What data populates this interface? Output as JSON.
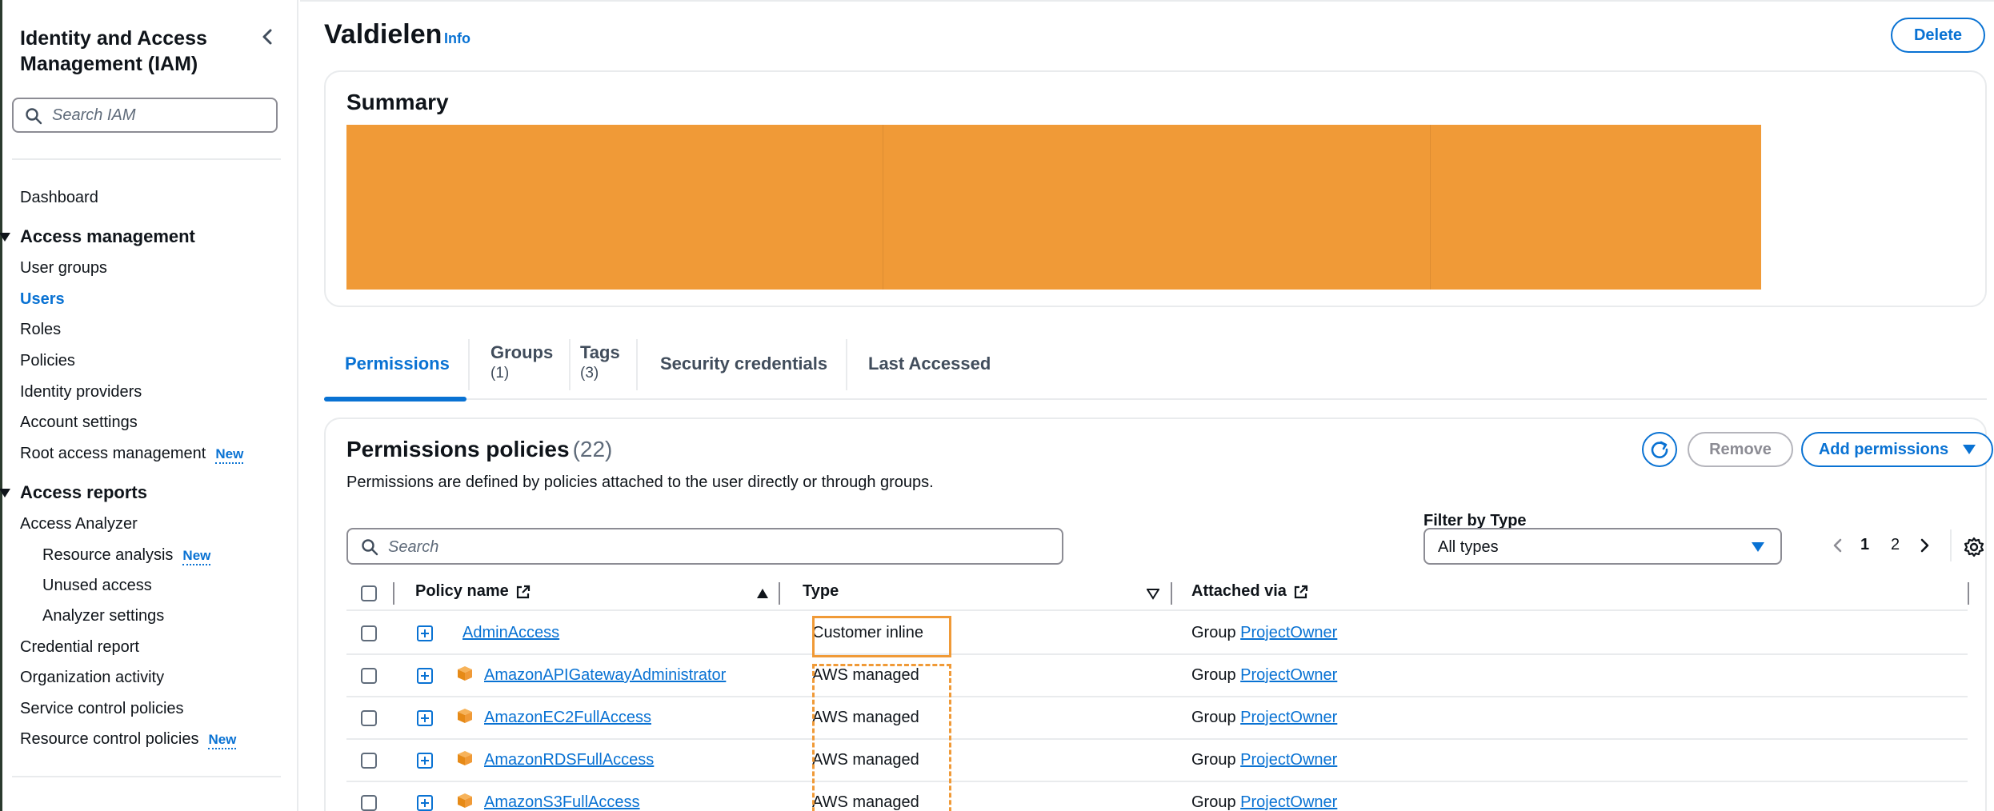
{
  "sidebar": {
    "title": "Identity and Access Management (IAM)",
    "search_placeholder": "Search IAM",
    "dashboard": "Dashboard",
    "access_management": {
      "label": "Access management",
      "items": [
        "User groups",
        "Users",
        "Roles",
        "Policies",
        "Identity providers",
        "Account settings",
        "Root access management"
      ],
      "active": "Users",
      "new_badge_item": "Root access management"
    },
    "access_reports": {
      "label": "Access reports",
      "analyzer": "Access Analyzer",
      "analyzer_items": [
        "Resource analysis",
        "Unused access",
        "Analyzer settings"
      ],
      "items": [
        "Credential report",
        "Organization activity",
        "Service control policies",
        "Resource control policies"
      ]
    },
    "new_label": "New"
  },
  "header": {
    "title": "Valdielen",
    "info": "Info",
    "delete": "Delete"
  },
  "summary": {
    "heading": "Summary",
    "redaction_color": "#f09a37"
  },
  "tabs": [
    {
      "label": "Permissions",
      "count": "",
      "active": true
    },
    {
      "label": "Groups",
      "count": "(1)"
    },
    {
      "label": "Tags",
      "count": "(3)"
    },
    {
      "label": "Security credentials",
      "count": ""
    },
    {
      "label": "Last Accessed",
      "count": ""
    }
  ],
  "permissions": {
    "heading": "Permissions policies",
    "count": "(22)",
    "description": "Permissions are defined by policies attached to the user directly or through groups.",
    "remove": "Remove",
    "add": "Add permissions",
    "filter_label": "Filter by Type",
    "filter_value": "All types",
    "search_placeholder": "Search",
    "pages": [
      "1",
      "2"
    ],
    "current_page": "1",
    "columns": {
      "name": "Policy name",
      "type": "Type",
      "attached": "Attached via"
    },
    "rows": [
      {
        "name": "AdminAccess",
        "type": "Customer inline",
        "via": "Group",
        "group": "ProjectOwner",
        "icon": ""
      },
      {
        "name": "AmazonAPIGatewayAdministrator",
        "type": "AWS managed",
        "via": "Group",
        "group": "ProjectOwner",
        "icon": "aws-box-icon"
      },
      {
        "name": "AmazonEC2FullAccess",
        "type": "AWS managed",
        "via": "Group",
        "group": "ProjectOwner",
        "icon": "aws-box-icon"
      },
      {
        "name": "AmazonRDSFullAccess",
        "type": "AWS managed",
        "via": "Group",
        "group": "ProjectOwner",
        "icon": "aws-box-icon"
      },
      {
        "name": "AmazonS3FullAccess",
        "type": "AWS managed",
        "via": "Group",
        "group": "ProjectOwner",
        "icon": "aws-box-icon"
      }
    ]
  },
  "colors": {
    "accent": "#0972d3",
    "highlight": "#f09a37"
  }
}
